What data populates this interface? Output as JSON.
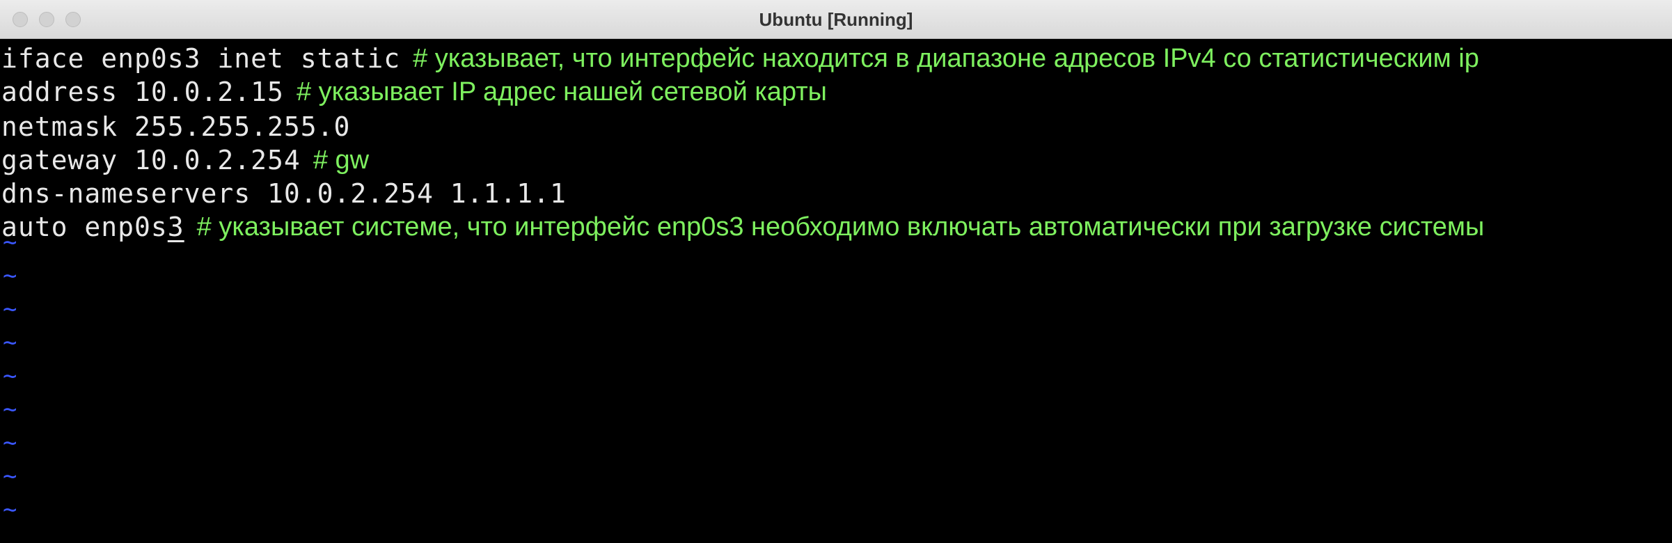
{
  "window": {
    "title": "Ubuntu [Running]"
  },
  "editor": {
    "lines": [
      {
        "code": "iface enp0s3 inet static",
        "comment": "# указывает, что интерфейс находится в диапазоне адресов IPv4 со статистическим ip"
      },
      {
        "code": "address 10.0.2.15",
        "comment": "# указывает IP адрес нашей сетевой карты"
      },
      {
        "code": "netmask 255.255.255.0",
        "comment": ""
      },
      {
        "code": "gateway 10.0.2.254",
        "comment": "# gw"
      },
      {
        "code": "dns-nameservers 10.0.2.254 1.1.1.1",
        "comment": ""
      },
      {
        "code_before_cursor": "auto enp0s",
        "cursor_char": "3",
        "comment": "# указывает системе, что интерфейс enp0s3 необходимо включать автоматически при загрузке системы"
      }
    ],
    "empty_line_marker": "~",
    "colors": {
      "background": "#000000",
      "code": "#e8e8e8",
      "comment": "#7ef05f",
      "tilde": "#3a57ff"
    }
  }
}
